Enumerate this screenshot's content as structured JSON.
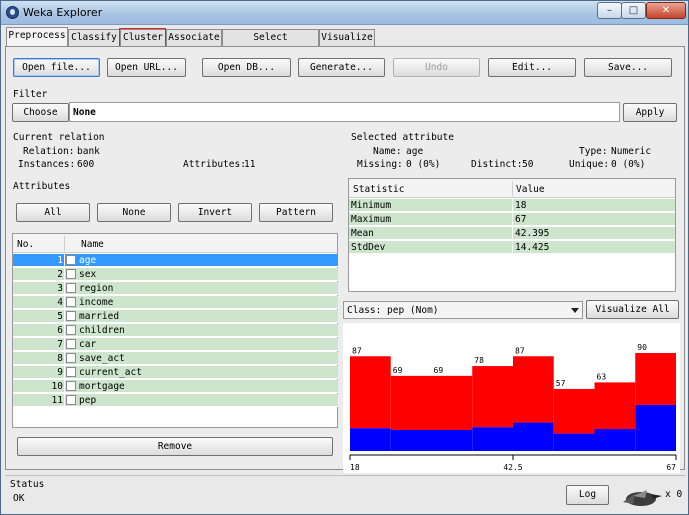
{
  "window": {
    "title": "Weka Explorer",
    "min": "–",
    "max": "□",
    "close": "✕"
  },
  "tabs": [
    "Preprocess",
    "Classify",
    "Cluster",
    "Associate",
    "Select attributes",
    "Visualize"
  ],
  "toolbar": {
    "open_file": "Open file...",
    "open_url": "Open URL...",
    "open_db": "Open DB...",
    "generate": "Generate...",
    "undo": "Undo",
    "edit": "Edit...",
    "save": "Save..."
  },
  "filter": {
    "title": "Filter",
    "choose": "Choose",
    "value": "None",
    "apply": "Apply"
  },
  "relation": {
    "title": "Current relation",
    "relation_label": "Relation:",
    "relation_value": "bank",
    "instances_label": "Instances:",
    "instances_value": "600",
    "attributes_label": "Attributes:",
    "attributes_value": "11"
  },
  "attributes": {
    "title": "Attributes",
    "all": "All",
    "none": "None",
    "invert": "Invert",
    "pattern": "Pattern",
    "col_no": "No.",
    "col_name": "Name",
    "remove": "Remove",
    "rows": [
      {
        "no": "1",
        "name": "age"
      },
      {
        "no": "2",
        "name": "sex"
      },
      {
        "no": "3",
        "name": "region"
      },
      {
        "no": "4",
        "name": "income"
      },
      {
        "no": "5",
        "name": "married"
      },
      {
        "no": "6",
        "name": "children"
      },
      {
        "no": "7",
        "name": "car"
      },
      {
        "no": "8",
        "name": "save_act"
      },
      {
        "no": "9",
        "name": "current_act"
      },
      {
        "no": "10",
        "name": "mortgage"
      },
      {
        "no": "11",
        "name": "pep"
      }
    ]
  },
  "selected": {
    "title": "Selected attribute",
    "name_label": "Name:",
    "name_value": "age",
    "type_label": "Type:",
    "type_value": "Numeric",
    "missing_label": "Missing:",
    "missing_value": "0 (0%)",
    "distinct_label": "Distinct:",
    "distinct_value": "50",
    "unique_label": "Unique:",
    "unique_value": "0 (0%)",
    "col_stat": "Statistic",
    "col_value": "Value",
    "stats": [
      {
        "k": "Minimum",
        "v": "18"
      },
      {
        "k": "Maximum",
        "v": "67"
      },
      {
        "k": "Mean",
        "v": "42.395"
      },
      {
        "k": "StdDev",
        "v": "14.425"
      }
    ]
  },
  "class": {
    "label": "Class: pep (Nom)",
    "visualize_all": "Visualize All"
  },
  "chart_data": {
    "type": "bar",
    "title": "",
    "counts": [
      87,
      69,
      69,
      78,
      87,
      57,
      63,
      90
    ],
    "series": [
      {
        "name": "",
        "color": "#ff0000"
      },
      {
        "name": "",
        "color": "#0000ff"
      }
    ],
    "blue_fraction": [
      0.24,
      0.28,
      0.28,
      0.28,
      0.3,
      0.28,
      0.32,
      0.47
    ],
    "xticks": [
      "18",
      "42.5",
      "67"
    ],
    "xlim": [
      18,
      67
    ]
  },
  "status": {
    "title": "Status",
    "value": "OK",
    "log": "Log",
    "x_count": "x 0"
  },
  "colors": {
    "selected_row": "#3399ff",
    "row_bg": "#cde5cd",
    "red": "#ff0000",
    "blue": "#0000ff"
  }
}
